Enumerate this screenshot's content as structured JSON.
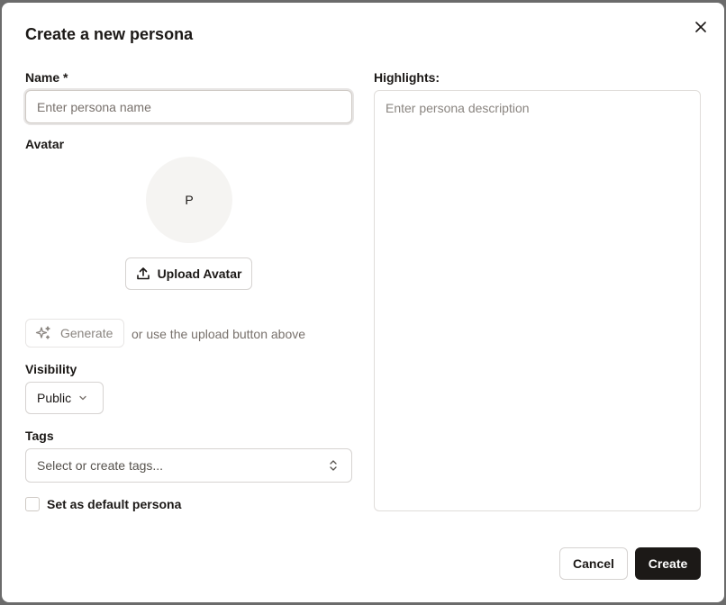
{
  "dialog": {
    "title": "Create a new persona",
    "close_icon": "close-icon"
  },
  "name": {
    "label": "Name *",
    "value": "",
    "placeholder": "Enter persona name"
  },
  "avatar": {
    "label": "Avatar",
    "initial": "P",
    "upload_label": "Upload Avatar",
    "upload_icon": "upload-icon",
    "generate_label": "Generate",
    "generate_icon": "sparkles-icon",
    "generate_hint": "or use the upload button above"
  },
  "visibility": {
    "label": "Visibility",
    "selected": "Public",
    "icon": "chevron-down-icon"
  },
  "tags": {
    "label": "Tags",
    "placeholder": "Select or create tags...",
    "icon": "chevrons-up-down-icon"
  },
  "default_persona": {
    "label": "Set as default persona",
    "checked": false
  },
  "highlights": {
    "label": "Highlights:",
    "value": "",
    "placeholder": "Enter persona description"
  },
  "footer": {
    "cancel_label": "Cancel",
    "create_label": "Create"
  },
  "colors": {
    "primary": "#1c1917",
    "muted_text": "#78716c",
    "border": "#d6d3d1",
    "avatar_bg": "#f5f4f2"
  }
}
